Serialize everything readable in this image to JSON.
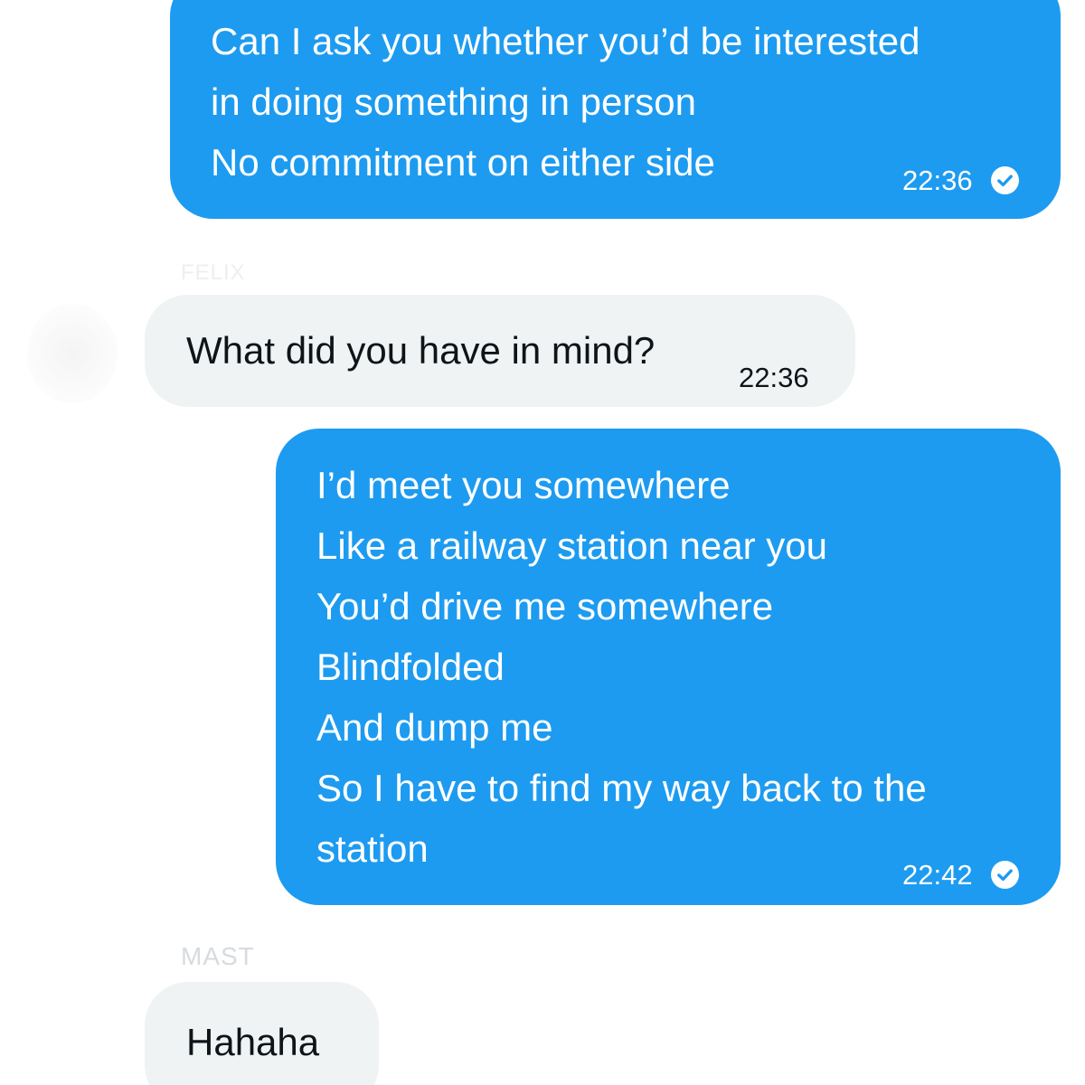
{
  "messages": [
    {
      "direction": "outgoing",
      "lines": [
        "Can I ask you whether you’d be interested",
        "in doing something in person",
        "No commitment on either side"
      ],
      "time": "22:36",
      "status_icon": "read-check-icon"
    },
    {
      "direction": "incoming",
      "sender": "FELIX",
      "lines": [
        "What did you have in mind?"
      ],
      "time": "22:36"
    },
    {
      "direction": "outgoing",
      "lines": [
        "I’d meet you somewhere",
        "Like a railway station near you",
        "You’d drive me somewhere",
        "Blindfolded",
        "And dump me",
        "So I have to find my way back to the",
        "station"
      ],
      "time": "22:42",
      "status_icon": "read-check-icon"
    },
    {
      "direction": "incoming",
      "sender": "MAST",
      "lines": [
        "Hahaha"
      ]
    }
  ],
  "colors": {
    "outgoing_bubble": "#1d9bf0",
    "incoming_bubble": "#eff3f4",
    "outgoing_text": "#ffffff",
    "incoming_text": "#0f1419"
  }
}
